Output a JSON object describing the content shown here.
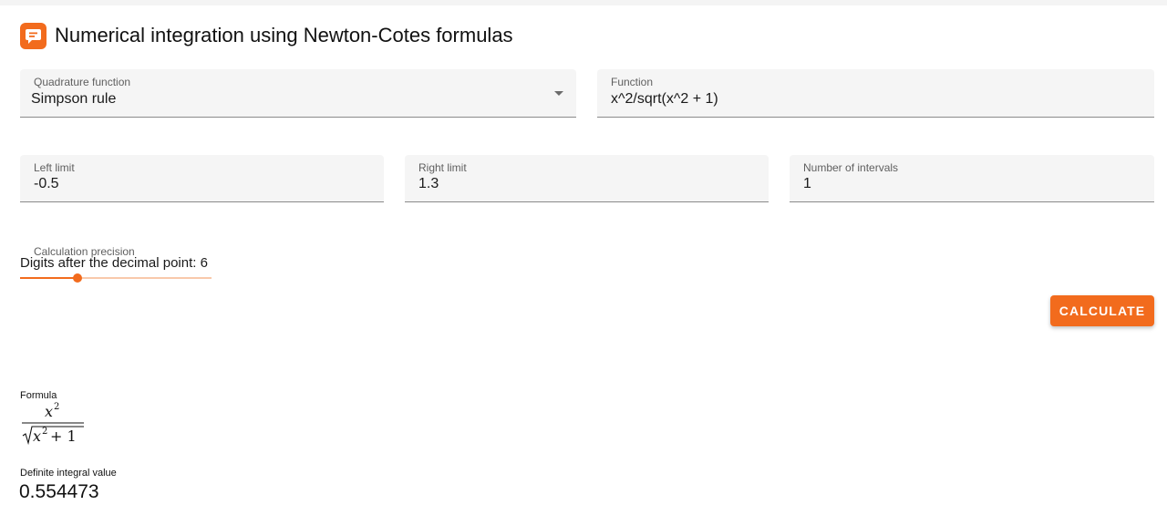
{
  "app": {
    "title": "Numerical integration using Newton-Cotes formulas",
    "logo_icon": "message-icon",
    "accent_color": "#f26b1d"
  },
  "form": {
    "quadrature": {
      "label": "Quadrature function",
      "value": "Simpson rule",
      "icon": "chevron-down-icon"
    },
    "function": {
      "label": "Function",
      "value": "x^2/sqrt(x^2 + 1)"
    },
    "left_limit": {
      "label": "Left limit",
      "value": "-0.5"
    },
    "right_limit": {
      "label": "Right limit",
      "value": "1.3"
    },
    "intervals": {
      "label": "Number of intervals",
      "value": "1"
    },
    "precision": {
      "label": "Calculation precision",
      "text": "Digits after the decimal point: 6",
      "value": 6,
      "level": 0.3
    },
    "calculate_label": "CALCULATE"
  },
  "result": {
    "formula_label": "Formula",
    "formula": {
      "numerator_base": "x",
      "numerator_exp": "2",
      "denominator_base": "x",
      "denominator_exp": "2",
      "denominator_tail": "+ 1"
    },
    "integral_label": "Definite integral value",
    "integral_value": "0.554473"
  }
}
